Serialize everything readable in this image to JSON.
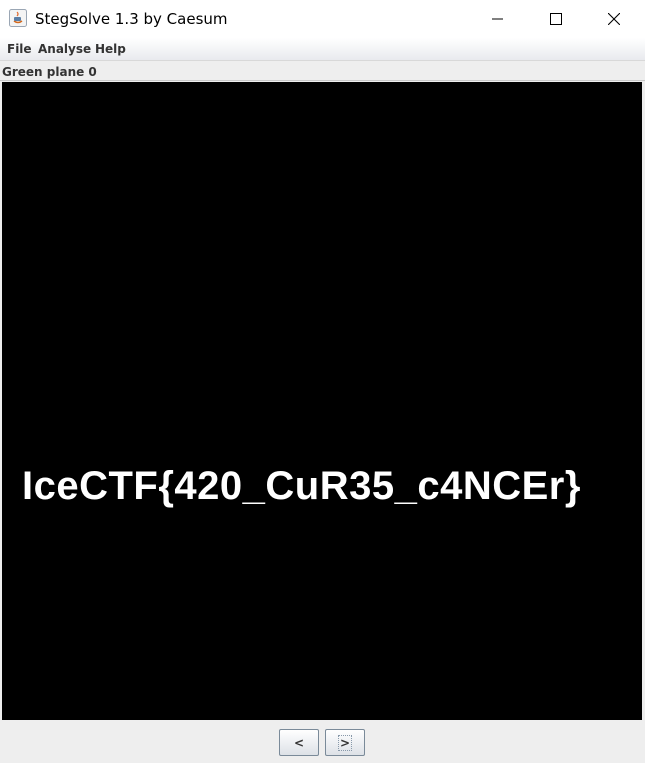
{
  "window": {
    "title": "StegSolve 1.3 by Caesum",
    "controls": {
      "minimize_icon": "minimize-icon",
      "maximize_icon": "maximize-icon",
      "close_icon": "close-icon"
    }
  },
  "menubar": {
    "items": [
      {
        "label": "File"
      },
      {
        "label": "Analyse"
      },
      {
        "label": "Help"
      }
    ]
  },
  "viewer": {
    "plane_label": "Green plane 0",
    "image_text": "IceCTF{420_CuR35_c4NCEr}",
    "background_color": "#000000",
    "text_color": "#ffffff"
  },
  "navigation": {
    "prev_label": "<",
    "next_label": ">"
  }
}
